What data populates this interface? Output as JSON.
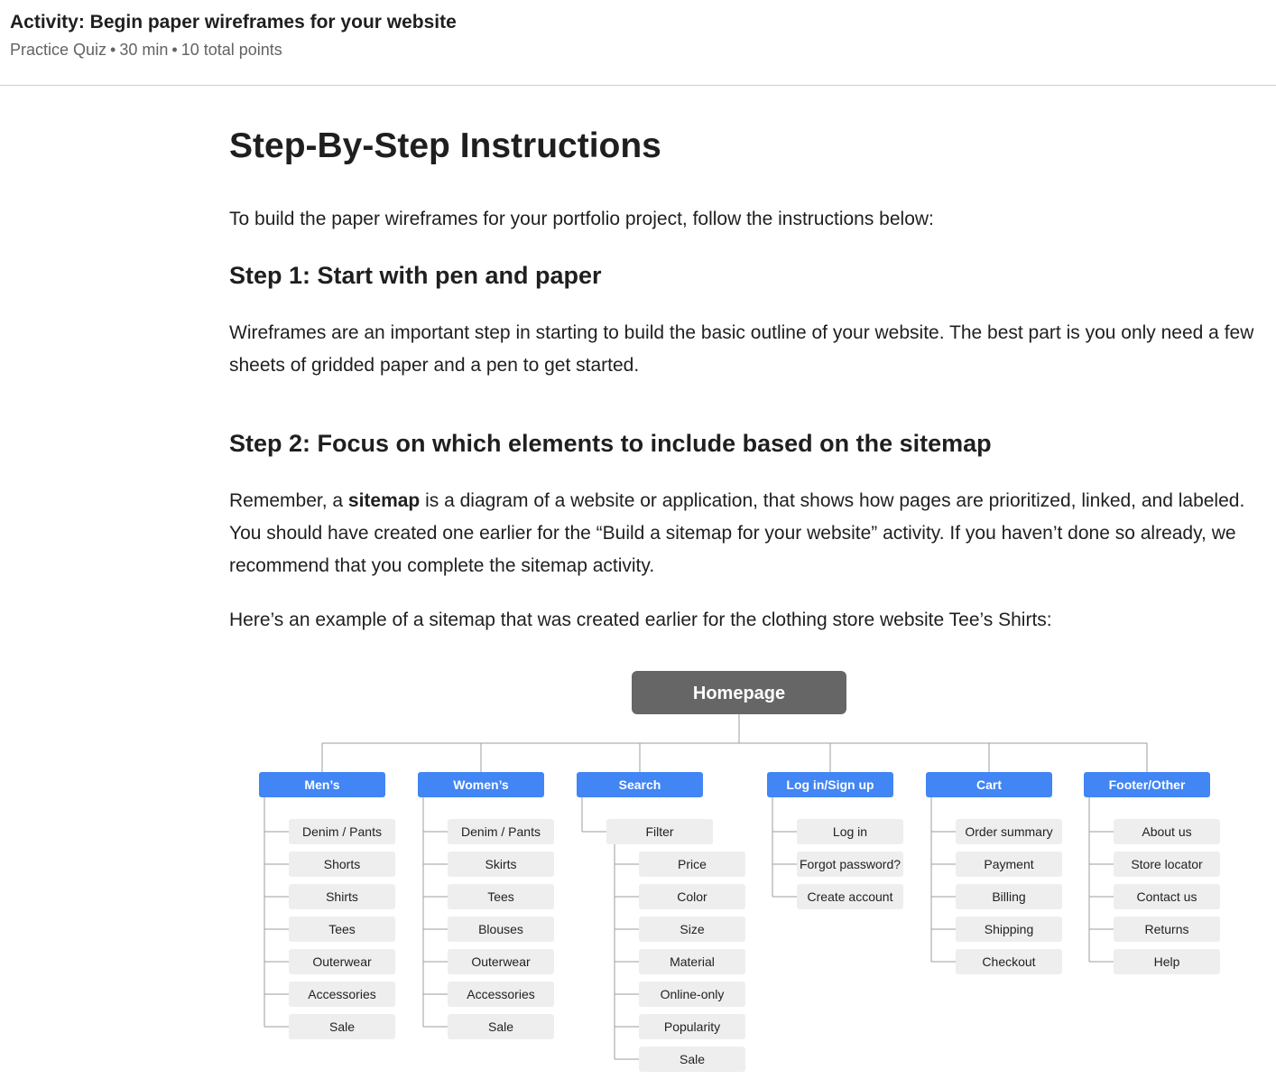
{
  "header": {
    "title": "Activity: Begin paper wireframes for your website",
    "type": "Practice Quiz",
    "duration": "30 min",
    "points": "10 total points",
    "separator": "•"
  },
  "content": {
    "heading": "Step-By-Step Instructions",
    "intro": "To build the paper wireframes for your portfolio project, follow the instructions below:",
    "step1": {
      "heading": "Step 1: Start with pen and paper",
      "body": "Wireframes are an important step in starting to build the basic outline of your website. The best part is you only need a few sheets of gridded paper and a pen to get started."
    },
    "step2": {
      "heading": "Step 2: Focus on which elements to include based on the sitemap",
      "body_pre": "Remember, a ",
      "body_bold": "sitemap",
      "body_post": " is a diagram of a website or application, that shows how pages are prioritized, linked, and labeled. You should have created one earlier for the “Build a sitemap for your website” activity.  If you haven’t done so already, we recommend that you complete the sitemap activity.",
      "example": "Here’s an example of a sitemap that was created earlier for the clothing store website Tee’s Shirts:"
    }
  },
  "sitemap": {
    "root": "Homepage",
    "root_color": "#666666",
    "category_color": "#4285f4",
    "item_color": "#eeeeee",
    "columns": [
      {
        "label": "Men’s",
        "items": [
          "Denim / Pants",
          "Shorts",
          "Shirts",
          "Tees",
          "Outerwear",
          "Accessories",
          "Sale"
        ]
      },
      {
        "label": "Women’s",
        "items": [
          "Denim / Pants",
          "Skirts",
          "Tees",
          "Blouses",
          "Outerwear",
          "Accessories",
          "Sale"
        ]
      },
      {
        "label": "Search",
        "items": [
          "Filter"
        ],
        "subitems": [
          "Price",
          "Color",
          "Size",
          "Material",
          "Online-only",
          "Popularity",
          "Sale"
        ]
      },
      {
        "label": "Log in/Sign up",
        "items": [
          "Log in",
          "Forgot password?",
          "Create account"
        ]
      },
      {
        "label": "Cart",
        "items": [
          "Order summary",
          "Payment",
          "Billing",
          "Shipping",
          "Checkout"
        ]
      },
      {
        "label": "Footer/Other",
        "items": [
          "About us",
          "Store locator",
          "Contact us",
          "Returns",
          "Help"
        ]
      }
    ]
  }
}
